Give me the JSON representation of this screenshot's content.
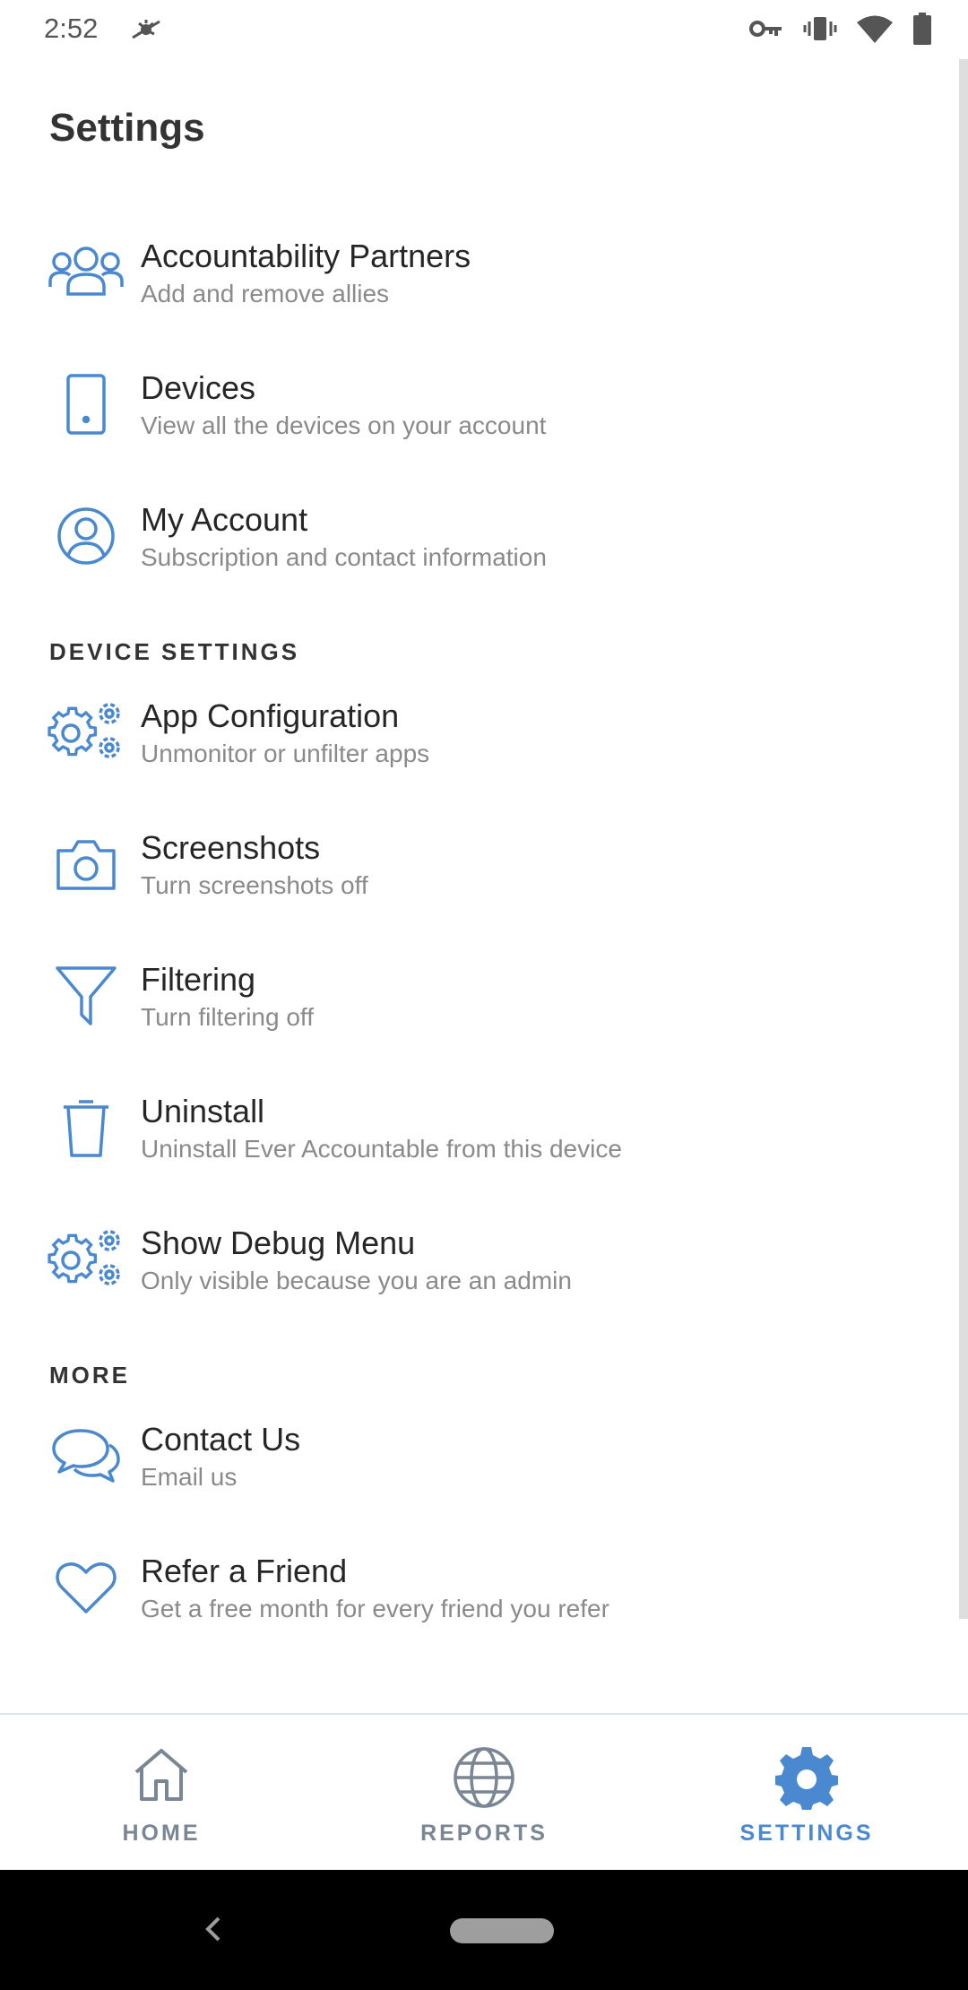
{
  "status_bar": {
    "time": "2:52",
    "icons": [
      "debug-icon",
      "key-icon",
      "vibrate-icon",
      "wifi-icon",
      "battery-icon"
    ]
  },
  "page": {
    "title": "Settings"
  },
  "sections": {
    "account": {
      "items": [
        {
          "icon": "people-icon",
          "title": "Accountability Partners",
          "subtitle": "Add and remove allies"
        },
        {
          "icon": "phone-icon",
          "title": "Devices",
          "subtitle": "View all the devices on your account"
        },
        {
          "icon": "user-circle-icon",
          "title": "My Account",
          "subtitle": "Subscription and contact information"
        }
      ]
    },
    "device_settings": {
      "header": "DEVICE SETTINGS",
      "items": [
        {
          "icon": "gears-icon",
          "title": "App Configuration",
          "subtitle": "Unmonitor or unfilter apps"
        },
        {
          "icon": "camera-icon",
          "title": "Screenshots",
          "subtitle": "Turn screenshots off"
        },
        {
          "icon": "filter-icon",
          "title": "Filtering",
          "subtitle": "Turn filtering off"
        },
        {
          "icon": "trash-icon",
          "title": "Uninstall",
          "subtitle": "Uninstall Ever Accountable from this device"
        },
        {
          "icon": "gears-icon",
          "title": "Show Debug Menu",
          "subtitle": "Only visible because you are an admin"
        }
      ]
    },
    "more": {
      "header": "MORE",
      "items": [
        {
          "icon": "chat-icon",
          "title": "Contact Us",
          "subtitle": "Email us"
        },
        {
          "icon": "heart-icon",
          "title": "Refer a Friend",
          "subtitle": "Get a free month for every friend you refer"
        }
      ]
    }
  },
  "bottom_nav": {
    "tabs": [
      {
        "icon": "home-icon",
        "label": "HOME",
        "active": false
      },
      {
        "icon": "globe-icon",
        "label": "REPORTS",
        "active": false
      },
      {
        "icon": "gear-icon",
        "label": "SETTINGS",
        "active": true
      }
    ]
  },
  "colors": {
    "accent": "#4a89cf",
    "icon_stroke": "#4a89cf",
    "inactive_nav": "#7a8694",
    "subtitle": "#8a8a8a"
  }
}
